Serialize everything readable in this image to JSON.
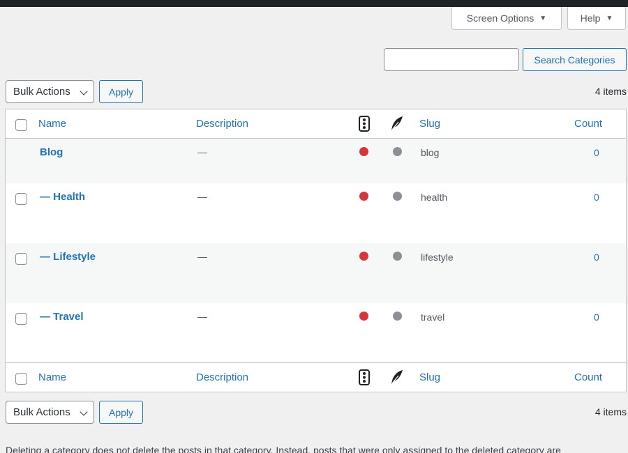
{
  "header": {
    "screen_options_label": "Screen Options",
    "help_label": "Help",
    "caret": "▼"
  },
  "search": {
    "value": "",
    "placeholder": "",
    "button_label": "Search Categories"
  },
  "tablenav_top": {
    "bulk_actions_selected": "Bulk Actions",
    "apply_label": "Apply",
    "items_count": "4 items"
  },
  "table": {
    "columns": {
      "name": "Name",
      "description": "Description",
      "traffic_icon": "traffic-light-icon",
      "quill_icon": "quill-icon",
      "slug": "Slug",
      "count": "Count"
    },
    "rows": [
      {
        "name": "Blog",
        "description": "—",
        "slug": "blog",
        "count": "0",
        "has_checkbox": false,
        "status_color": "#d63638",
        "secondary_color": "#8c8f94"
      },
      {
        "name": "— Health",
        "description": "—",
        "slug": "health",
        "count": "0",
        "has_checkbox": true,
        "status_color": "#d63638",
        "secondary_color": "#8c8f94"
      },
      {
        "name": "— Lifestyle",
        "description": "—",
        "slug": "lifestyle",
        "count": "0",
        "has_checkbox": true,
        "status_color": "#d63638",
        "secondary_color": "#8c8f94"
      },
      {
        "name": "— Travel",
        "description": "—",
        "slug": "travel",
        "count": "0",
        "has_checkbox": true,
        "status_color": "#d63638",
        "secondary_color": "#8c8f94"
      }
    ]
  },
  "tablenav_bottom": {
    "bulk_actions_selected": "Bulk Actions",
    "apply_label": "Apply",
    "items_count": "4 items"
  },
  "footer_note": "Deleting a category does not delete the posts in that category. Instead, posts that were only assigned to the deleted category are",
  "colors": {
    "link": "#2271b1",
    "admin_bar": "#1d2327",
    "background": "#f0f0f1"
  }
}
